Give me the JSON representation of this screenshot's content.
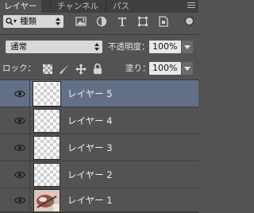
{
  "tabs": [
    {
      "label": "レイヤー",
      "active": true
    },
    {
      "label": "チャンネル",
      "active": false
    },
    {
      "label": "パス",
      "active": false
    }
  ],
  "filter": {
    "kind_label": "種類",
    "icons": [
      "image-filter-icon",
      "adjustment-filter-icon",
      "type-filter-icon",
      "shape-filter-icon",
      "smart-object-filter-icon"
    ]
  },
  "blend": {
    "mode": "通常",
    "opacity_label": "不透明度：",
    "opacity_value": "100%"
  },
  "lock": {
    "label": "ロック：",
    "icons": [
      "lock-transparent-icon",
      "lock-image-icon",
      "lock-position-icon",
      "lock-all-icon"
    ],
    "fill_label": "塗り：",
    "fill_value": "100%"
  },
  "layers": [
    {
      "name": "レイヤー 5",
      "selected": true,
      "visible": true
    },
    {
      "name": "レイヤー 4",
      "selected": false,
      "visible": true
    },
    {
      "name": "レイヤー 3",
      "selected": false,
      "visible": true
    },
    {
      "name": "レイヤー 2",
      "selected": false,
      "visible": true
    },
    {
      "name": "レイヤー 1",
      "selected": false,
      "visible": true
    }
  ],
  "colors": {
    "panel_bg": "#535353",
    "selected_row": "#627087",
    "tab_bar": "#3f3f3f"
  }
}
